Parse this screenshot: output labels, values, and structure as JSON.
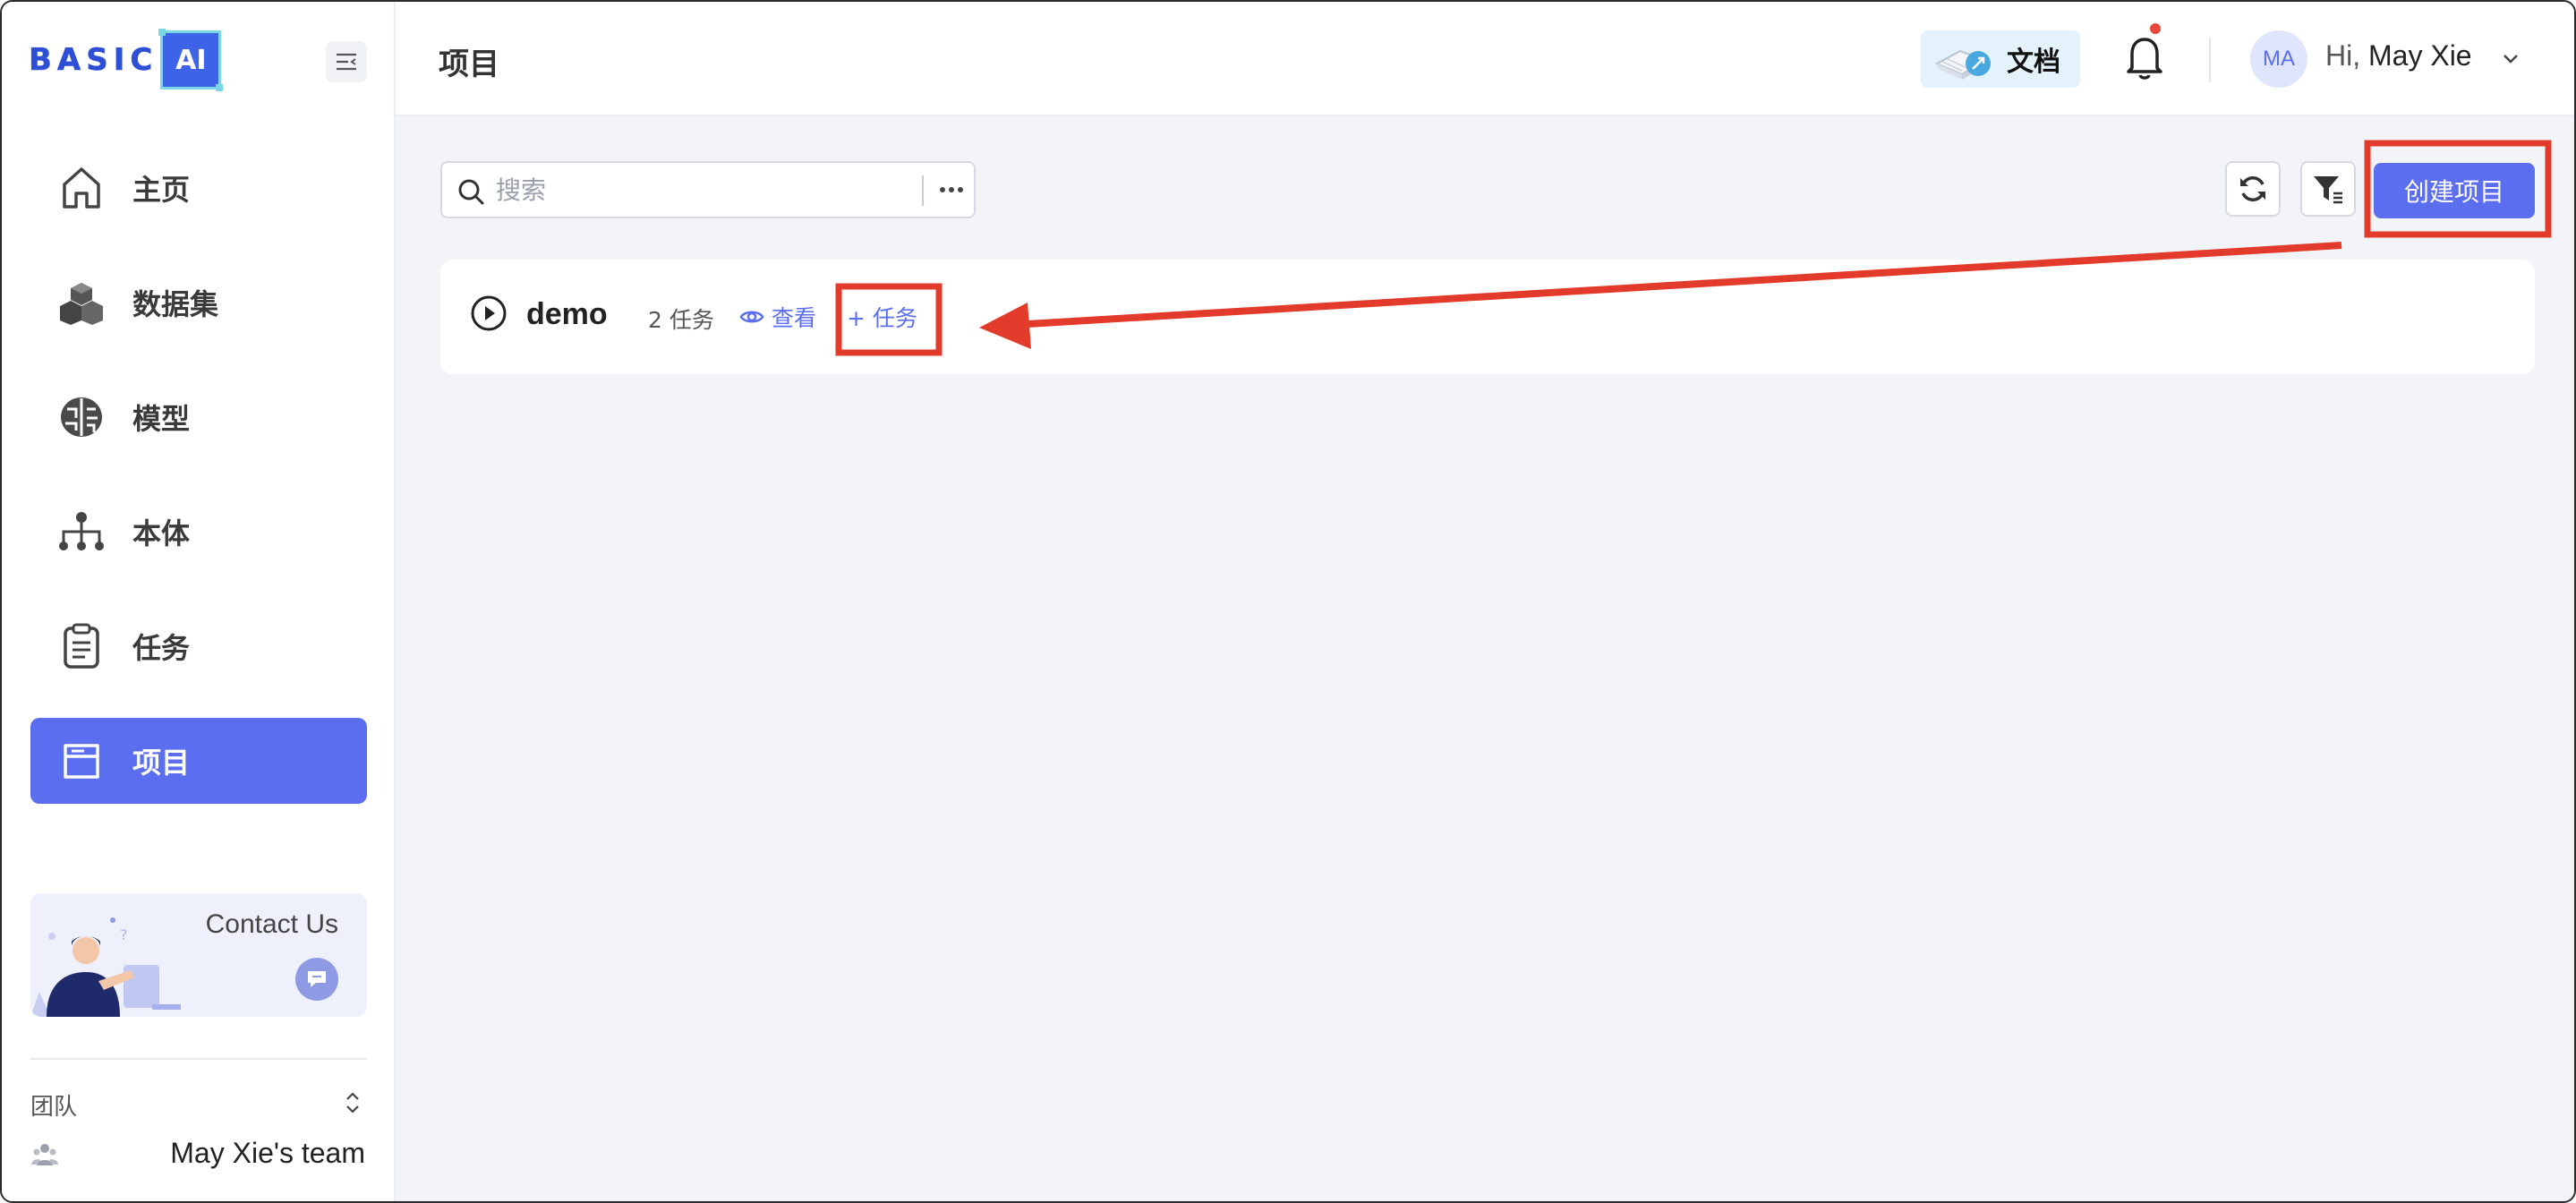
{
  "brand": {
    "name": "BASIC",
    "suffix": "AI"
  },
  "sidebar": {
    "items": [
      {
        "label": "主页",
        "icon": "home-icon",
        "active": false
      },
      {
        "label": "数据集",
        "icon": "cubes-icon",
        "active": false
      },
      {
        "label": "模型",
        "icon": "brain-icon",
        "active": false
      },
      {
        "label": "本体",
        "icon": "hierarchy-icon",
        "active": false
      },
      {
        "label": "任务",
        "icon": "clipboard-icon",
        "active": false
      },
      {
        "label": "项目",
        "icon": "folder-icon",
        "active": true
      }
    ],
    "contact": {
      "title": "Contact Us"
    },
    "team": {
      "label": "团队",
      "name": "May Xie's team"
    }
  },
  "header": {
    "title": "项目",
    "docs_label": "文档",
    "avatar_initials": "MA",
    "greeting": "Hi,",
    "user_name": "May Xie"
  },
  "main": {
    "search": {
      "placeholder": "搜索",
      "value": ""
    },
    "create_button": "创建项目",
    "project": {
      "name": "demo",
      "task_count": "2 任务",
      "view_label": "查看",
      "add_task_label": "+ 任务"
    }
  },
  "colors": {
    "accent": "#5b6ef0",
    "annotation_red": "#e23b2c",
    "main_background": "#f3f4f8",
    "notification_dot": "#e5483b"
  }
}
